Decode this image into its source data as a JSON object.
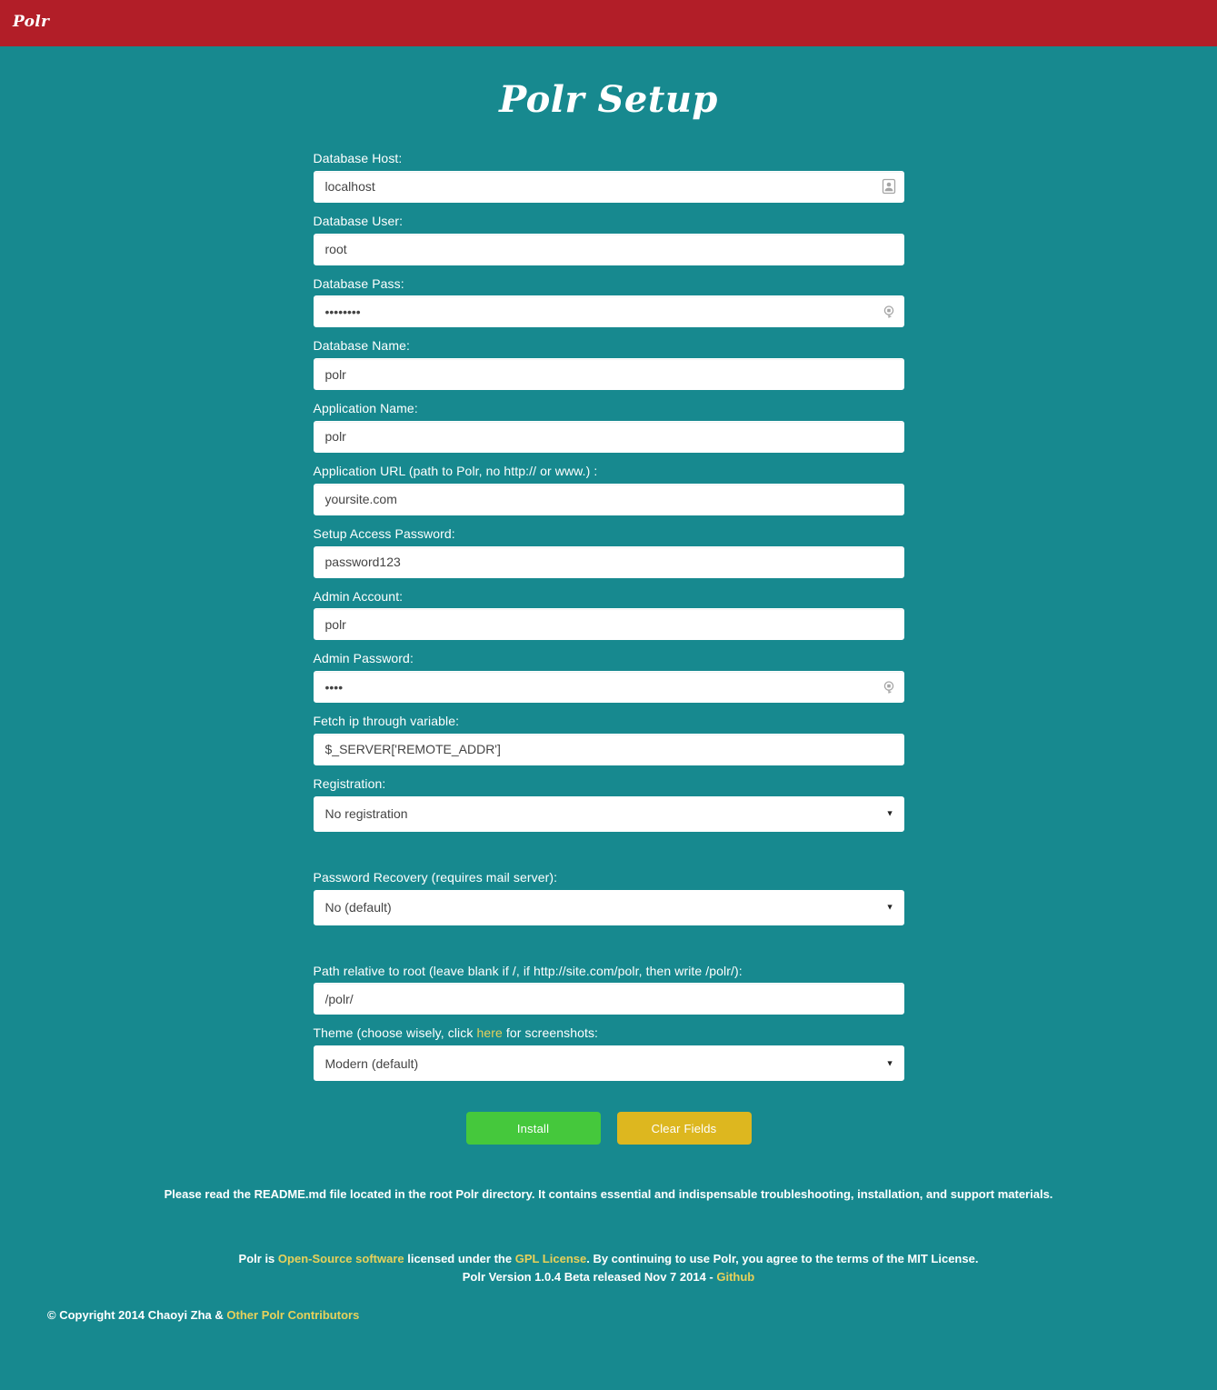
{
  "navbar": {
    "brand": "Polr"
  },
  "page": {
    "title": "Polr Setup"
  },
  "form": {
    "fields": [
      {
        "key": "database_host",
        "label": "Database Host:",
        "value": "localhost",
        "type": "text",
        "icon": "autofill-contact-icon"
      },
      {
        "key": "database_user",
        "label": "Database User:",
        "value": "root",
        "type": "text",
        "icon": ""
      },
      {
        "key": "database_pass",
        "label": "Database Pass:",
        "value": "password",
        "type": "password",
        "icon": "password-key-icon"
      },
      {
        "key": "database_name",
        "label": "Database Name:",
        "value": "polr",
        "type": "text",
        "icon": ""
      },
      {
        "key": "application_name",
        "label": "Application Name:",
        "value": "polr",
        "type": "text",
        "icon": ""
      },
      {
        "key": "application_url",
        "label": "Application URL (path to Polr, no http:// or www.) :",
        "value": "yoursite.com",
        "type": "text",
        "icon": ""
      },
      {
        "key": "setup_access_password",
        "label": "Setup Access Password:",
        "value": "password123",
        "type": "text",
        "icon": ""
      },
      {
        "key": "admin_account",
        "label": "Admin Account:",
        "value": "polr",
        "type": "text",
        "icon": ""
      },
      {
        "key": "admin_password",
        "label": "Admin Password:",
        "value": "polr",
        "type": "password",
        "icon": "password-key-icon"
      },
      {
        "key": "fetch_ip_variable",
        "label": "Fetch ip through variable:",
        "value": "$_SERVER['REMOTE_ADDR']",
        "type": "text",
        "icon": ""
      }
    ],
    "registration": {
      "label": "Registration:",
      "selected": "No registration",
      "options": [
        "No registration"
      ]
    },
    "password_recovery": {
      "label": "Password Recovery (requires mail server):",
      "selected": "No (default)",
      "options": [
        "No (default)"
      ]
    },
    "path_relative": {
      "label": "Path relative to root (leave blank if /, if http://site.com/polr, then write /polr/):",
      "value": "/polr/"
    },
    "theme": {
      "label_before": "Theme (choose wisely, click ",
      "label_link": "here",
      "label_after": " for screenshots:",
      "selected": "Modern (default)",
      "options": [
        "Modern (default)"
      ]
    },
    "buttons": {
      "install": "Install",
      "clear": "Clear Fields"
    }
  },
  "notes": {
    "readme": "Please read the README.md file located in the root Polr directory. It contains essential and indispensable troubleshooting, installation, and support materials."
  },
  "footer": {
    "line1_part1": "Polr is ",
    "line1_link1": "Open-Source software",
    "line1_part2": " licensed under the ",
    "line1_link2": "GPL License",
    "line1_part3": ". By continuing to use Polr, you agree to the terms of the MIT License.",
    "line2_part1": "Polr Version 1.0.4 Beta released Nov 7 2014 - ",
    "line2_link": "Github",
    "copyright_part1": "© Copyright 2014 Chaoyi Zha & ",
    "copyright_link": "Other Polr Contributors"
  },
  "colors": {
    "navbar_red": "#b21e28",
    "background_teal": "#17898f",
    "install_green": "#45c83c",
    "clear_gold": "#ddb71f",
    "link_yellow": "#e8d15a"
  }
}
